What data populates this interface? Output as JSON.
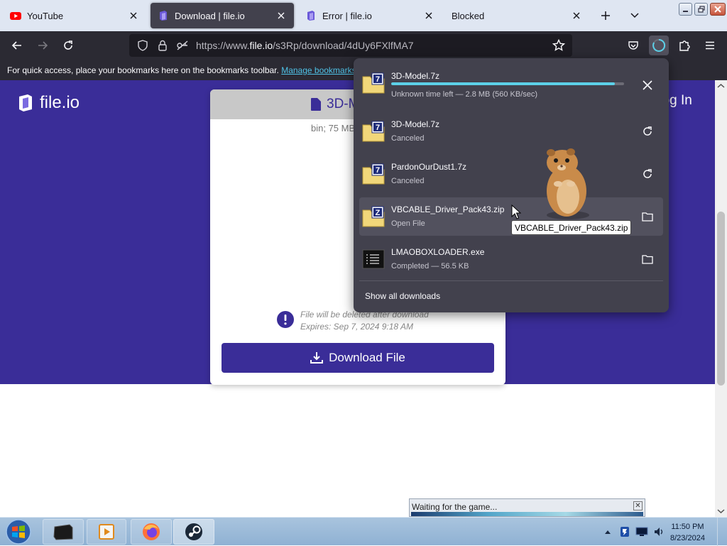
{
  "browser": {
    "tabs": [
      {
        "label": "YouTube",
        "active": false
      },
      {
        "label": "Download | file.io",
        "active": true
      },
      {
        "label": "Error | file.io",
        "active": false
      },
      {
        "label": "Blocked",
        "active": false
      }
    ],
    "url": {
      "prefix": "https://www.",
      "domain": "file.io",
      "path": "/s3Rp/download/4dUy6FXlfMA7"
    },
    "bookmarks_bar": {
      "text": "For quick access, place your bookmarks here on the bookmarks toolbar.",
      "link": "Manage bookmarks…"
    }
  },
  "page": {
    "logo_text": "file.io",
    "login_text": "Log In",
    "card": {
      "filename": "3D-Model.7z",
      "meta": "bin; 75 MB",
      "notice_line1": "File will be deleted after download",
      "notice_line2": "Expires: Sep 7, 2024 9:18 AM",
      "download_button": "Download File"
    }
  },
  "downloads_panel": {
    "items": [
      {
        "name": "3D-Model.7z",
        "status": "Unknown time left — 2.8 MB (560 KB/sec)",
        "progress": 0.96,
        "icon": "7z-archive-icon",
        "action": "cancel"
      },
      {
        "name": "3D-Model.7z",
        "status": "Canceled",
        "icon": "7z-archive-icon",
        "action": "retry"
      },
      {
        "name": "PardonOurDust1.7z",
        "status": "Canceled",
        "icon": "7z-archive-icon",
        "action": "retry"
      },
      {
        "name": "VBCABLE_Driver_Pack43.zip",
        "status": "Open File",
        "icon": "zip-archive-icon",
        "action": "show-in-folder"
      },
      {
        "name": "LMAOBOXLOADER.exe",
        "status": "Completed — 56.5 KB",
        "icon": "exe-icon",
        "action": "show-in-folder"
      }
    ],
    "show_all": "Show all downloads"
  },
  "tooltip": "VBCABLE_Driver_Pack43.zip",
  "waiting_window": {
    "title": "Waiting for the game..."
  },
  "taskbar": {
    "time": "11:50 PM",
    "date": "8/23/2024"
  },
  "colors": {
    "accent": "#3a2d98",
    "progress": "#5cd0e8",
    "panel": "#42414d",
    "toolbar": "#2b2a33"
  }
}
